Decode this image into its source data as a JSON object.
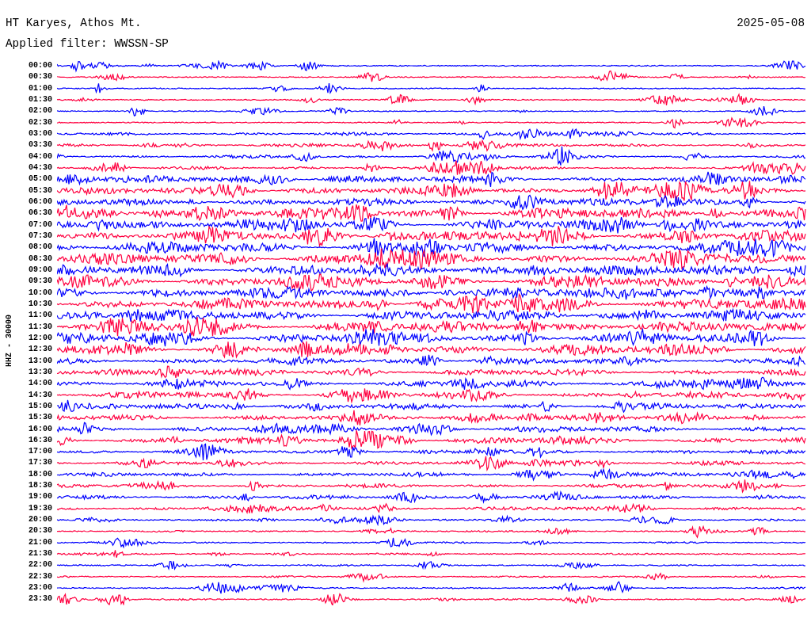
{
  "header": {
    "station": "HT Karyes, Athos Mt.",
    "date": "2025-05-08",
    "filter": "Applied filter: WWSSN-SP"
  },
  "channel_label": "HHZ - 30000",
  "rows": [
    {
      "time": "00:00",
      "color": "#0000ff"
    },
    {
      "time": "00:30",
      "color": "#ff0040"
    },
    {
      "time": "01:00",
      "color": "#0000ff"
    },
    {
      "time": "01:30",
      "color": "#ff0040"
    },
    {
      "time": "02:00",
      "color": "#0000ff"
    },
    {
      "time": "02:30",
      "color": "#ff0040"
    },
    {
      "time": "03:00",
      "color": "#0000ff"
    },
    {
      "time": "03:30",
      "color": "#ff0040"
    },
    {
      "time": "04:00",
      "color": "#0000ff"
    },
    {
      "time": "04:30",
      "color": "#ff0040"
    },
    {
      "time": "05:00",
      "color": "#0000ff"
    },
    {
      "time": "05:30",
      "color": "#ff0040"
    },
    {
      "time": "06:00",
      "color": "#0000ff"
    },
    {
      "time": "06:30",
      "color": "#ff0040"
    },
    {
      "time": "07:00",
      "color": "#0000ff"
    },
    {
      "time": "07:30",
      "color": "#ff0040"
    },
    {
      "time": "08:00",
      "color": "#0000ff"
    },
    {
      "time": "08:30",
      "color": "#ff0040"
    },
    {
      "time": "09:00",
      "color": "#0000ff"
    },
    {
      "time": "09:30",
      "color": "#ff0040"
    },
    {
      "time": "10:00",
      "color": "#0000ff"
    },
    {
      "time": "10:30",
      "color": "#ff0040"
    },
    {
      "time": "11:00",
      "color": "#0000ff"
    },
    {
      "time": "11:30",
      "color": "#ff0040"
    },
    {
      "time": "12:00",
      "color": "#0000ff"
    },
    {
      "time": "12:30",
      "color": "#ff0040"
    },
    {
      "time": "13:00",
      "color": "#0000ff"
    },
    {
      "time": "13:30",
      "color": "#ff0040"
    },
    {
      "time": "14:00",
      "color": "#0000ff"
    },
    {
      "time": "14:30",
      "color": "#ff0040"
    },
    {
      "time": "15:00",
      "color": "#0000ff"
    },
    {
      "time": "15:30",
      "color": "#ff0040"
    },
    {
      "time": "16:00",
      "color": "#0000ff"
    },
    {
      "time": "16:30",
      "color": "#ff0040"
    },
    {
      "time": "17:00",
      "color": "#0000ff"
    },
    {
      "time": "17:30",
      "color": "#ff0040"
    },
    {
      "time": "18:00",
      "color": "#0000ff"
    },
    {
      "time": "18:30",
      "color": "#ff0040"
    },
    {
      "time": "19:00",
      "color": "#0000ff"
    },
    {
      "time": "19:30",
      "color": "#ff0040"
    },
    {
      "time": "20:00",
      "color": "#0000ff"
    },
    {
      "time": "20:30",
      "color": "#ff0040"
    },
    {
      "time": "21:00",
      "color": "#0000ff"
    },
    {
      "time": "21:30",
      "color": "#ff0040"
    },
    {
      "time": "22:00",
      "color": "#0000ff"
    },
    {
      "time": "22:30",
      "color": "#ff0040"
    },
    {
      "time": "23:00",
      "color": "#0000ff"
    },
    {
      "time": "23:30",
      "color": "#ff0040"
    }
  ]
}
